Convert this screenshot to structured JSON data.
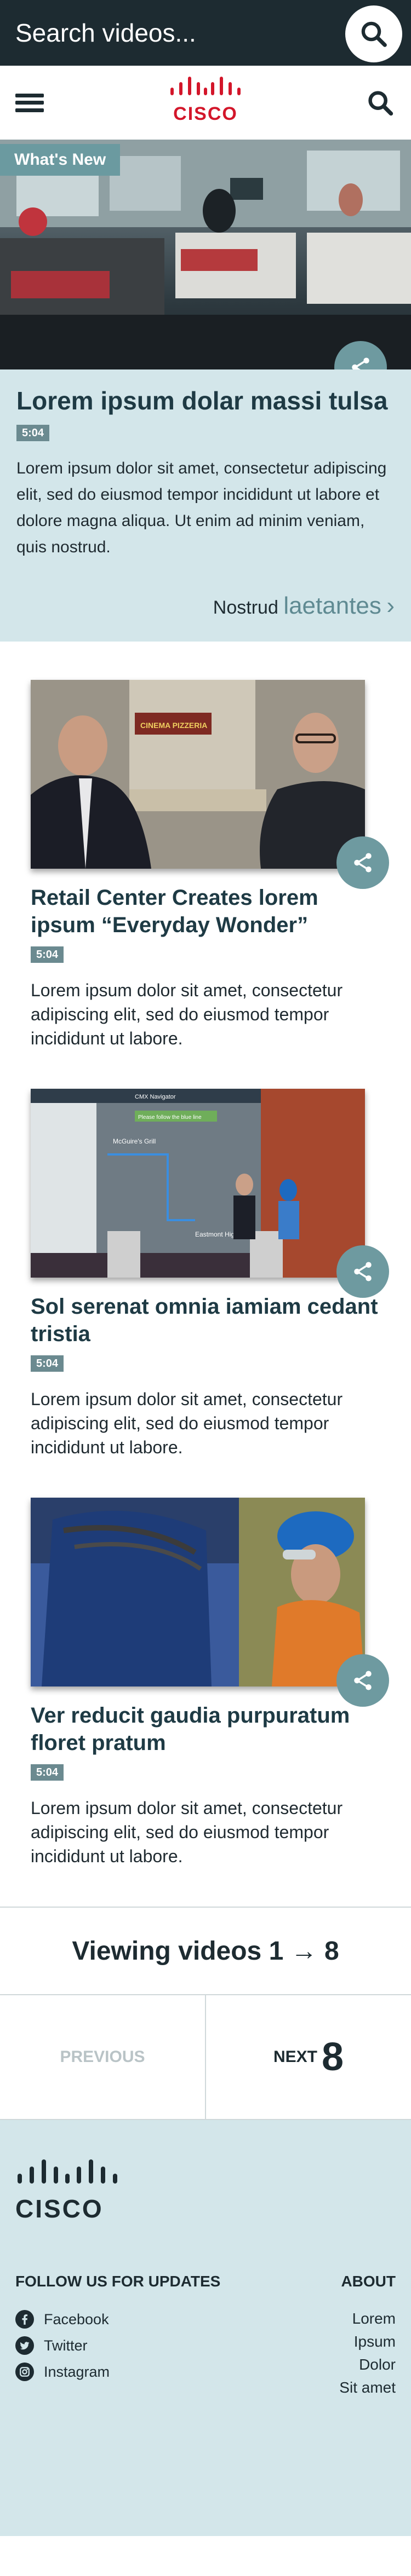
{
  "search": {
    "placeholder": "Search videos..."
  },
  "header": {
    "logo_text": "CISCO"
  },
  "featured": {
    "badge": "What's New",
    "title": "Lorem ipsum dolar massi tulsa",
    "duration": "5:04",
    "description": "Lorem ipsum dolor sit amet, consectetur adipiscing elit, sed do eiusmod tempor incididunt ut labore et dolore magna aliqua. Ut enim ad minim veniam, quis nostrud.",
    "more_prefix": "Nostrud",
    "more_accent": "laetantes",
    "more_arrow": "›"
  },
  "videos": [
    {
      "title": "Retail Center Creates lorem ipsum “Everyday Wonder”",
      "duration": "5:04",
      "description": "Lorem ipsum dolor sit amet, consectetur adipiscing elit, sed do eiusmod tempor incididunt ut labore.",
      "sign_text": "CINEMA PIZZERIA"
    },
    {
      "title": "Sol serenat omnia iamiam cedant tristia",
      "duration": "5:04",
      "description": "Lorem ipsum dolor sit amet, consectetur adipiscing elit, sed do eiusmod tempor incididunt ut labore.",
      "screen_header": "CMX Navigator",
      "screen_banner": "Please follow the blue line",
      "map_label_1": "McGuire's Grill",
      "map_label_2": "Eastmont High School"
    },
    {
      "title": "Ver reducit gaudia purpuratum floret pratum",
      "duration": "5:04",
      "description": "Lorem ipsum dolor sit amet, consectetur adipiscing elit, sed do eiusmod tempor incididunt ut labore."
    }
  ],
  "pagination": {
    "viewing": "Viewing videos 1 → 8",
    "previous": "PREVIOUS",
    "next_label": "NEXT",
    "next_number": "8"
  },
  "footer": {
    "logo_text": "CISCO",
    "follow_heading": "FOLLOW US FOR UPDATES",
    "social": [
      "Facebook",
      "Twitter",
      "Instagram"
    ],
    "about_heading": "ABOUT",
    "about_items": [
      "Lorem",
      "Ipsum",
      "Dolor",
      "Sit amet"
    ]
  },
  "colors": {
    "dark": "#1d2b31",
    "brand_red": "#d3162a",
    "light_teal": "#d3e6ea",
    "accent_teal": "#6e9aa0"
  }
}
